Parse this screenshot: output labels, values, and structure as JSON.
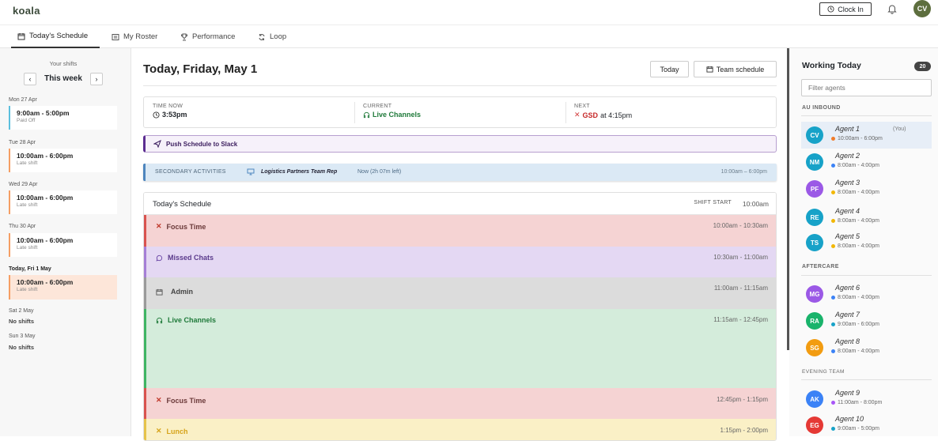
{
  "app": {
    "logo": "koala",
    "clock_in": "Clock In",
    "avatar": "CV"
  },
  "tabs": [
    {
      "label": "Today's Schedule",
      "icon": "calendar-icon",
      "active": true
    },
    {
      "label": "My Roster",
      "icon": "roster-icon",
      "active": false
    },
    {
      "label": "Performance",
      "icon": "trophy-icon",
      "active": false
    },
    {
      "label": "Loop",
      "icon": "loop-icon",
      "active": false
    }
  ],
  "shifts": {
    "heading": "Your shifts",
    "week_label": "This week",
    "days": [
      {
        "day": "Mon 27 Apr",
        "time": "9:00am - 5:00pm",
        "type": "Paid Off",
        "color": "#5bc0de"
      },
      {
        "day": "Tue 28 Apr",
        "time": "10:00am - 6:00pm",
        "type": "Late shift",
        "color": "#f59e64"
      },
      {
        "day": "Wed 29 Apr",
        "time": "10:00am - 6:00pm",
        "type": "Late shift",
        "color": "#f59e64"
      },
      {
        "day": "Thu 30 Apr",
        "time": "10:00am - 6:00pm",
        "type": "Late shift",
        "color": "#f59e64"
      },
      {
        "day": "Today, Fri 1 May",
        "time": "10:00am - 6:00pm",
        "type": "Late shift",
        "color": "#f59e64"
      },
      {
        "day": "Sat 2 May",
        "no_shift": "No shifts"
      },
      {
        "day": "Sun 3 May",
        "no_shift": "No shifts"
      }
    ]
  },
  "main": {
    "title": "Today, Friday, May 1",
    "today_button": "Today",
    "team_button": "Team schedule",
    "time_now_label": "TIME NOW",
    "time_now": "3:53pm",
    "current_label": "CURRENT",
    "current": "Live Channels",
    "next_label": "NEXT",
    "next_code": "GSD",
    "next_time": "at 4:15pm",
    "slack_button": "Push Schedule to Slack",
    "secondary": {
      "label": "SECONDARY ACTIVITIES",
      "activity": "Logistics Partners Team Rep",
      "status": "Now (2h 07m left)",
      "range": "10:00am – 6:00pm"
    },
    "schedule_title": "Today's Schedule",
    "shift_start_label": "SHIFT START",
    "shift_start": "10:00am",
    "blocks": [
      {
        "label": "Focus Time",
        "range": "10:00am - 10:30am",
        "icon": "x-icon"
      },
      {
        "label": "Missed Chats",
        "range": "10:30am - 11:00am",
        "icon": "chat-icon"
      },
      {
        "label": "Admin",
        "range": "11:00am - 11:15am",
        "icon": "calendar-icon"
      },
      {
        "label": "Live Channels",
        "range": "11:15am - 12:45pm",
        "icon": "headset-icon"
      },
      {
        "label": "Focus Time",
        "range": "12:45pm - 1:15pm",
        "icon": "x-icon"
      },
      {
        "label": "Lunch",
        "range": "1:15pm - 2:00pm",
        "icon": "utensils-icon"
      }
    ]
  },
  "working": {
    "title": "Working Today",
    "count": "20",
    "filter_placeholder": "Filter agents",
    "groups": [
      {
        "name": "AU INBOUND",
        "agents": [
          {
            "initials": "CV",
            "name": "Agent 1",
            "you": "(You)",
            "hours": "10:00am - 6:00pm",
            "color": "#17a2c8",
            "dot": "#f07c2a"
          },
          {
            "initials": "NM",
            "name": "Agent 2",
            "hours": "8:00am - 4:00pm",
            "color": "#17a2c8",
            "dot": "#3b82f6"
          },
          {
            "initials": "PF",
            "name": "Agent 3",
            "hours": "8:00am - 4:00pm",
            "color": "#9b59e6",
            "dot": "#f2b705"
          },
          {
            "initials": "RE",
            "name": "Agent 4",
            "hours": "8:00am - 4:00pm",
            "color": "#17a2c8",
            "dot": "#f2b705"
          },
          {
            "initials": "TS",
            "name": "Agent 5",
            "hours": "8:00am - 4:00pm",
            "color": "#17a2c8",
            "dot": "#f2b705"
          }
        ]
      },
      {
        "name": "AFTERCARE",
        "agents": [
          {
            "initials": "MG",
            "name": "Agent 6",
            "hours": "8:00am - 4:00pm",
            "color": "#9b59e6",
            "dot": "#3b82f6"
          },
          {
            "initials": "RA",
            "name": "Agent 7",
            "hours": "9:00am - 6:00pm",
            "color": "#19b36b",
            "dot": "#17a2c8"
          },
          {
            "initials": "SG",
            "name": "Agent 8",
            "hours": "8:00am - 4:00pm",
            "color": "#f29c11",
            "dot": "#3b82f6"
          }
        ]
      },
      {
        "name": "EVENING TEAM",
        "agents": [
          {
            "initials": "AK",
            "name": "Agent 9",
            "hours": "11:00am - 8:00pm",
            "color": "#3b82f6",
            "dot": "#a855f7"
          },
          {
            "initials": "EG",
            "name": "Agent 10",
            "hours": "9:00am - 5:00pm",
            "color": "#e53935",
            "dot": "#17a2c8"
          }
        ]
      }
    ]
  }
}
